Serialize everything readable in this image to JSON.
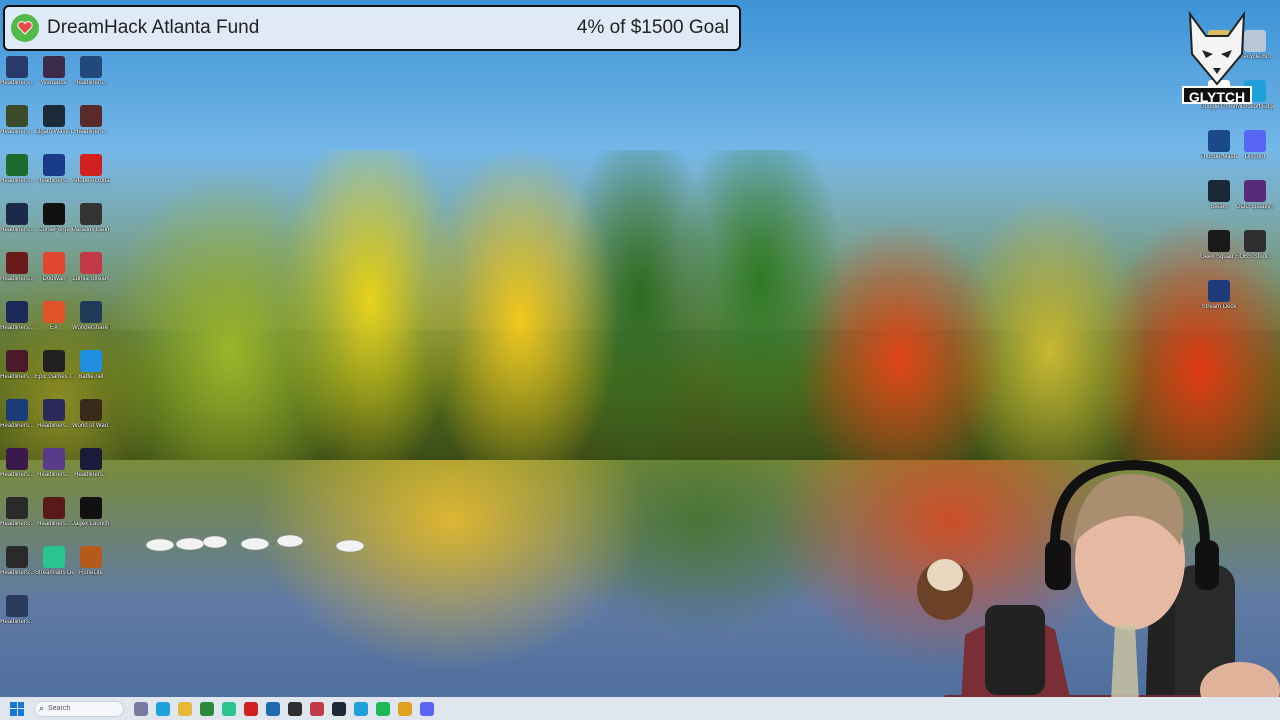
{
  "goal_banner": {
    "title": "DreamHack Atlanta Fund",
    "progress_text": "4% of $1500 Goal",
    "progress_fraction": 0.04,
    "accent_color": "#53b94a"
  },
  "streamer_logo": {
    "label": "GLYTCH"
  },
  "desktop_icons_left": [
    {
      "label": "Headliners...",
      "color": "#2a3a6a",
      "icon": "game-shortcut-icon"
    },
    {
      "label": "Wargarde",
      "color": "#3b2a4a",
      "icon": "game-shortcut-icon"
    },
    {
      "label": "Headliners...",
      "color": "#24487a",
      "icon": "game-shortcut-icon"
    },
    {
      "label": "Headliners...",
      "color": "#3a4a2a",
      "icon": "game-shortcut-icon"
    },
    {
      "label": "Elgato Wave Link",
      "color": "#1c2a3a",
      "icon": "webcam-app-icon"
    },
    {
      "label": "Headliners...",
      "color": "#5a2a2a",
      "icon": "game-shortcut-icon"
    },
    {
      "label": "Headliners...",
      "color": "#1f6b2f",
      "icon": "game-shortcut-icon"
    },
    {
      "label": "Headliners...",
      "color": "#1a3a8a",
      "icon": "game-shortcut-icon"
    },
    {
      "label": "Adobe Acrobat",
      "color": "#d21f1f",
      "icon": "acrobat-icon"
    },
    {
      "label": "Headliners...",
      "color": "#1a2a4a",
      "icon": "game-shortcut-icon"
    },
    {
      "label": "CurseForge",
      "color": "#111111",
      "icon": "curseforge-icon"
    },
    {
      "label": "Paradox Launcher v2",
      "color": "#333333",
      "icon": "paradox-icon"
    },
    {
      "label": "Headliners...",
      "color": "#6a1a1a",
      "icon": "game-shortcut-icon"
    },
    {
      "label": "DouWan",
      "color": "#e2462f",
      "icon": "douwan-icon"
    },
    {
      "label": "Lumia Stream",
      "color": "#c23a4a",
      "icon": "lumia-icon"
    },
    {
      "label": "Headliners...",
      "color": "#1a2a5a",
      "icon": "game-shortcut-icon"
    },
    {
      "label": "EA",
      "color": "#e0522a",
      "icon": "ea-icon"
    },
    {
      "label": "Wondershare Filmora14",
      "color": "#1f3b5a",
      "icon": "filmora-icon"
    },
    {
      "label": "Headliners...",
      "color": "#4a1a2a",
      "icon": "game-shortcut-icon"
    },
    {
      "label": "Epic Games Launcher",
      "color": "#222222",
      "icon": "epic-games-icon"
    },
    {
      "label": "Battle.net",
      "color": "#1e8fe0",
      "icon": "battlenet-icon"
    },
    {
      "label": "Headliners...",
      "color": "#1a3a7a",
      "icon": "game-shortcut-icon"
    },
    {
      "label": "Headliners...",
      "color": "#2a2a5a",
      "icon": "game-shortcut-icon"
    },
    {
      "label": "World of Warcraft",
      "color": "#3a2a1a",
      "icon": "wow-icon"
    },
    {
      "label": "Headliners...",
      "color": "#3a1a4a",
      "icon": "game-shortcut-icon"
    },
    {
      "label": "Headliners...",
      "color": "#5a3a8a",
      "icon": "game-shortcut-icon"
    },
    {
      "label": "Headliners...",
      "color": "#1a1a3a",
      "icon": "game-shortcut-icon"
    },
    {
      "label": "Headliners...",
      "color": "#2a2a2a",
      "icon": "game-shortcut-icon"
    },
    {
      "label": "Headliners...",
      "color": "#5a1a1a",
      "icon": "game-shortcut-icon"
    },
    {
      "label": "Jagex Launcher",
      "color": "#111111",
      "icon": "jagex-icon"
    },
    {
      "label": "Headliners...",
      "color": "#2a2a2a",
      "icon": "game-shortcut-icon"
    },
    {
      "label": "Streamlabs Desktop",
      "color": "#29c490",
      "icon": "streamlabs-icon"
    },
    {
      "label": "RuneLite",
      "color": "#b45a1a",
      "icon": "runelite-icon"
    },
    {
      "label": "Headliners...",
      "color": "#2a3a5a",
      "icon": "game-shortcut-icon"
    }
  ],
  "desktop_icons_right": [
    {
      "label": "Spotify",
      "color": "#d8c060",
      "icon": "folder-icon"
    },
    {
      "label": "Recycle Bin",
      "color": "#b9c8d8",
      "icon": "recycle-bin-icon"
    },
    {
      "label": "Google Chrome",
      "color": "#ffffff",
      "icon": "chrome-icon"
    },
    {
      "label": "Microsoft Edge",
      "color": "#1fa0d8",
      "icon": "edge-icon"
    },
    {
      "label": "ThunderMaster",
      "color": "#1a4a8a",
      "icon": "thundermaster-icon"
    },
    {
      "label": "Discord",
      "color": "#5865f2",
      "icon": "discord-icon"
    },
    {
      "label": "Steam",
      "color": "#1b2838",
      "icon": "steam-icon"
    },
    {
      "label": "GOG Galaxy Shortcut",
      "color": "#5a2a7a",
      "icon": "gog-icon"
    },
    {
      "label": "Geek Squad Support.exe",
      "color": "#1a1a1a",
      "icon": "app-icon"
    },
    {
      "label": "OBS Studio",
      "color": "#302e31",
      "icon": "obs-icon"
    },
    {
      "label": "Stream Deck",
      "color": "#1d3a7a",
      "icon": "stream-deck-icon"
    }
  ],
  "taskbar": {
    "search_placeholder": "Search",
    "pinned": [
      {
        "name": "taskbar-gallery-icon",
        "color": "#7a7aa0"
      },
      {
        "name": "taskbar-edge-icon",
        "color": "#1fa0d8"
      },
      {
        "name": "taskbar-file-explorer-icon",
        "color": "#e8b83a"
      },
      {
        "name": "taskbar-spreadsheet-icon",
        "color": "#2a8a3a"
      },
      {
        "name": "taskbar-streamlabs-icon",
        "color": "#29c490"
      },
      {
        "name": "taskbar-acrobat-icon",
        "color": "#d21f1f"
      },
      {
        "name": "taskbar-app-icon",
        "color": "#1f6ab0"
      },
      {
        "name": "taskbar-obs-icon",
        "color": "#302e31"
      },
      {
        "name": "taskbar-lumia-icon",
        "color": "#c23a4a"
      },
      {
        "name": "taskbar-steam-icon",
        "color": "#1b2838"
      },
      {
        "name": "taskbar-edge-2-icon",
        "color": "#1fa0d8"
      },
      {
        "name": "taskbar-spotify-icon",
        "color": "#1db954"
      },
      {
        "name": "taskbar-chrome-icon",
        "color": "#e0a020"
      },
      {
        "name": "taskbar-discord-icon",
        "color": "#5865f2"
      }
    ]
  }
}
